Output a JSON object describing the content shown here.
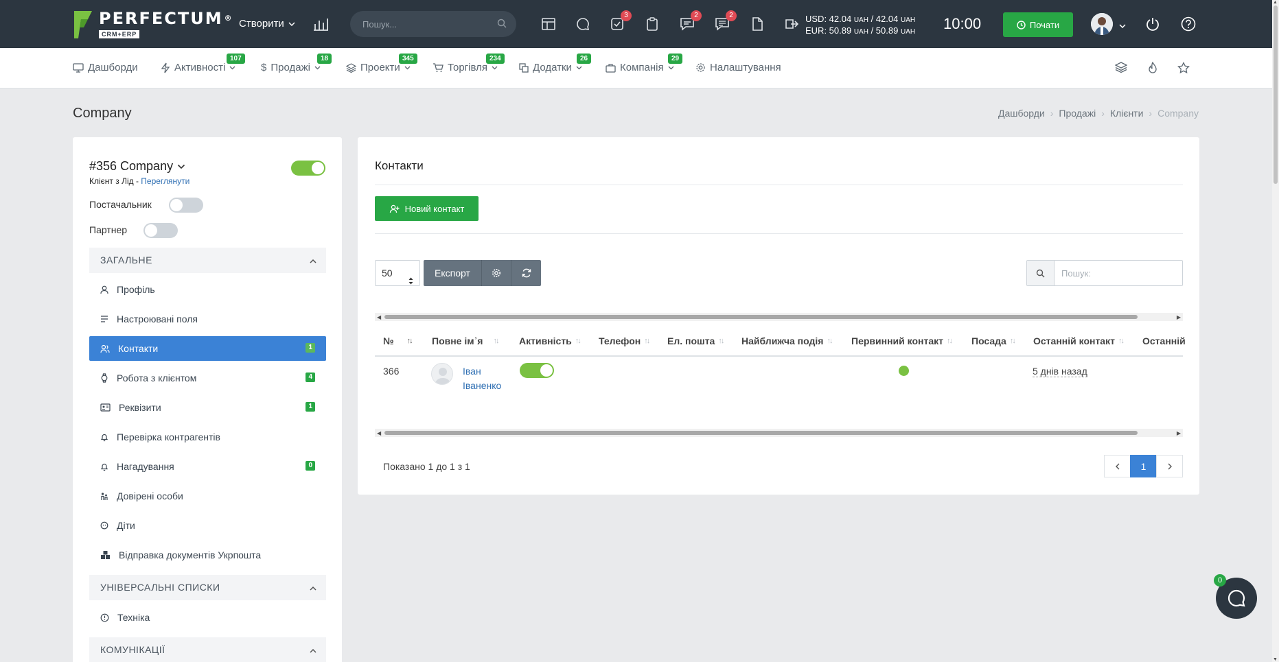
{
  "topbar": {
    "logo_title": "PERFECTUM",
    "logo_reg": "®",
    "logo_sub": "CRM+ERP",
    "create_label": "Створити",
    "search_placeholder": "Пошук...",
    "badges": {
      "tasks": "3",
      "messages": "2",
      "chat": "2"
    },
    "usd_line": "USD: 42.04",
    "usd_rest": "/ 42.04",
    "eur_line": "EUR: 50.89",
    "eur_rest": "/ 50.89",
    "currency_unit": "UAH",
    "time": "10:00",
    "start_label": "Почати"
  },
  "nav": {
    "items": [
      {
        "label": "Дашборди",
        "badge": ""
      },
      {
        "label": "Активності",
        "badge": "107"
      },
      {
        "label": "Продажі",
        "badge": "18"
      },
      {
        "label": "Проекти",
        "badge": "345"
      },
      {
        "label": "Торгівля",
        "badge": "234"
      },
      {
        "label": "Додатки",
        "badge": "26"
      },
      {
        "label": "Компанія",
        "badge": "29"
      },
      {
        "label": "Налаштування",
        "badge": ""
      }
    ]
  },
  "page": {
    "title": "Company",
    "breadcrumb": [
      "Дашборди",
      "Продажі",
      "Клієнти",
      "Company"
    ]
  },
  "sidebar": {
    "company_title": "#356 Company",
    "sub_prefix": "Клієнт з Лід - ",
    "sub_link": "Переглянути",
    "active_toggle_on": true,
    "supplier_label": "Постачальник",
    "partner_label": "Партнер",
    "sections": [
      {
        "title": "ЗАГАЛЬНЕ"
      },
      {
        "title": "УНІВЕРСАЛЬНІ СПИСКИ"
      },
      {
        "title": "КОМУНІКАЦІЇ"
      }
    ],
    "items": [
      {
        "label": "Профіль",
        "badge": ""
      },
      {
        "label": "Настроювані поля",
        "badge": ""
      },
      {
        "label": "Контакти",
        "badge": "1"
      },
      {
        "label": "Робота з клієнтом",
        "badge": "4"
      },
      {
        "label": "Реквізити",
        "badge": "1"
      },
      {
        "label": "Перевірка контрагентів",
        "badge": ""
      },
      {
        "label": "Нагадування",
        "badge": "0"
      },
      {
        "label": "Довірені особи",
        "badge": ""
      },
      {
        "label": "Діти",
        "badge": ""
      },
      {
        "label": "Відправка документів Укрпошта",
        "badge": ""
      },
      {
        "label": "Техніка",
        "badge": ""
      }
    ]
  },
  "main": {
    "title": "Контакти",
    "new_button": "Новий контакт",
    "page_size": "50",
    "export_label": "Експорт",
    "search_placeholder": "Пошук:",
    "columns": [
      "№",
      "Повне ім᾽я",
      "Активність",
      "Телефон",
      "Ел. пошта",
      "Найближча подія",
      "Первинний контакт",
      "Посада",
      "Останній контакт",
      "Останній"
    ],
    "rows": [
      {
        "num": "366",
        "name_first": "Іван",
        "name_last": "Іваненко",
        "active": true,
        "primary": true,
        "last_contact": "5 днів назад"
      }
    ],
    "showing": "Показано 1 до 1 з 1",
    "current_page": "1"
  },
  "chat": {
    "badge": "0"
  },
  "colors": {
    "topbar": "#2c3640",
    "green": "#28a745",
    "blue": "#3b82d6",
    "toggle_on": "#7ac142"
  }
}
